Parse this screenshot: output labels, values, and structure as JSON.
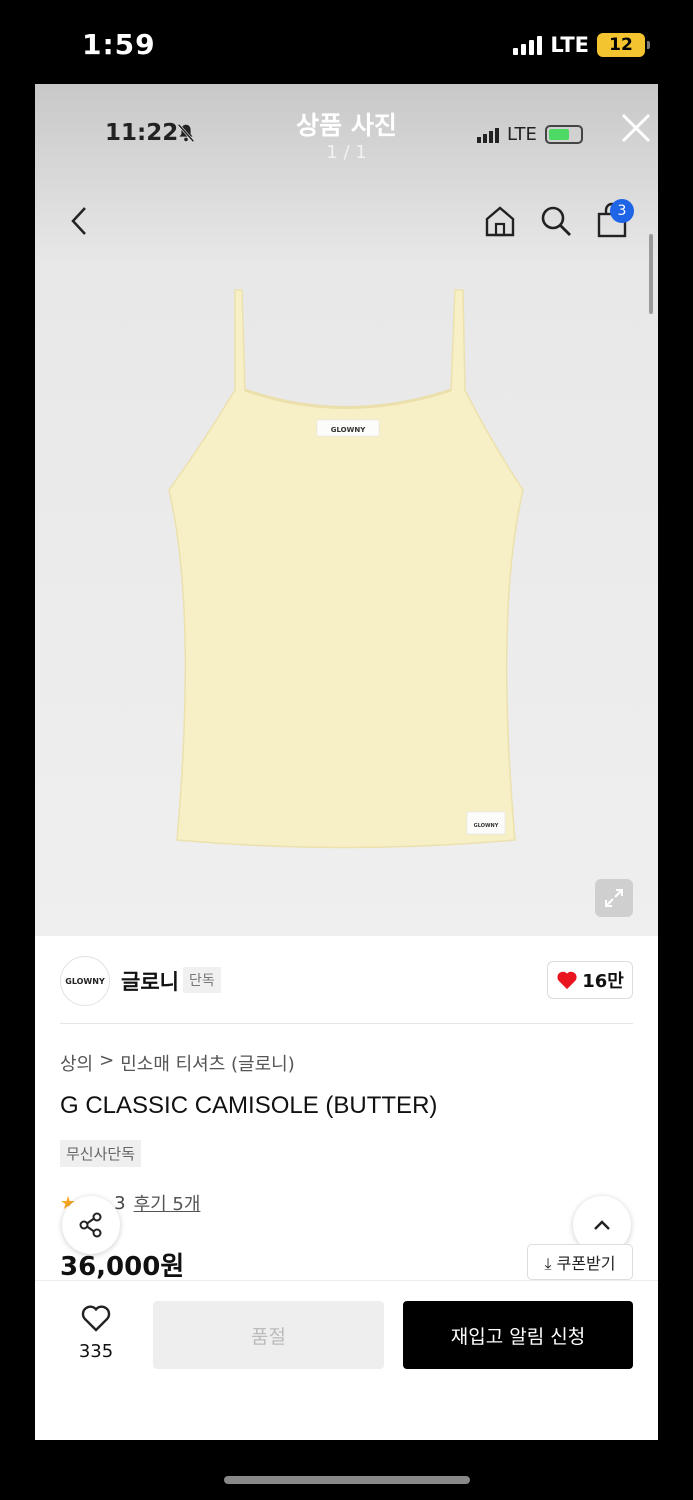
{
  "outer_status": {
    "time": "1:59",
    "network": "LTE",
    "battery": "12"
  },
  "viewer": {
    "title": "상품 사진",
    "count": "1 / 1"
  },
  "inner_status": {
    "time": "11:22",
    "network": "LTE"
  },
  "nav": {
    "cart_badge": "3"
  },
  "product_image": {
    "label_text_top": "GLOWNY",
    "label_text_bottom": "GLOWNY",
    "garment_color": "#f7efc6"
  },
  "brand": {
    "logo_text": "GLOWNY",
    "name": "글로니",
    "tag": "단독",
    "likes": "16만"
  },
  "breadcrumb": {
    "category": "상의",
    "separator": ">",
    "subcategory": "민소매 티셔츠 (글로니)"
  },
  "product": {
    "title": "G CLASSIC CAMISOLE (BUTTER)",
    "exclusive_badge": "무신사단독",
    "rating_partial": "3",
    "review_link": "후기 5개",
    "price": "36,000원",
    "coupon": "⤓ 쿠폰받기"
  },
  "bottom_bar": {
    "wish_count": "335",
    "soldout_label": "품절",
    "restock_label": "재입고 알림 신청"
  },
  "colors": {
    "accent_badge": "#1e64e6",
    "heart": "#e8141e",
    "button_dark": "#000000"
  }
}
